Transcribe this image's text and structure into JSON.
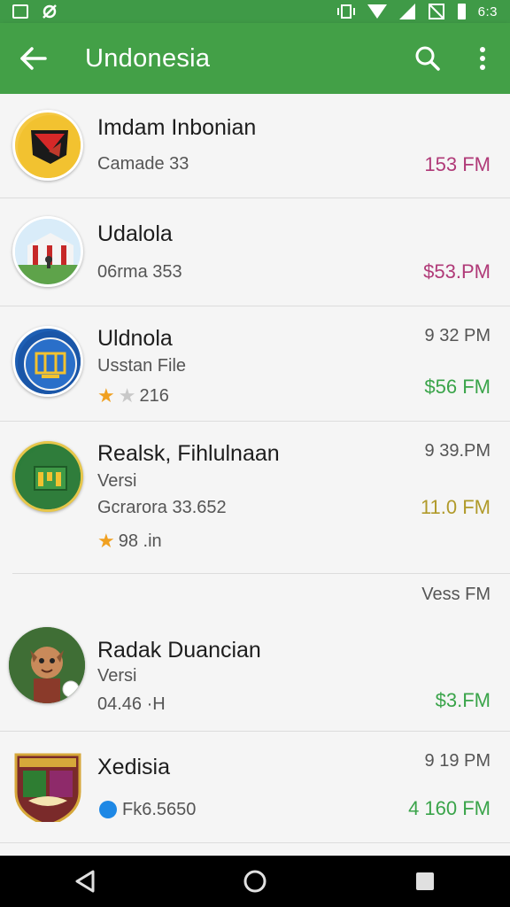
{
  "status": {
    "time": "6:3"
  },
  "appbar": {
    "title": "Undonesia",
    "bg_color": "#43a047"
  },
  "icons": {
    "back": "arrow-left-icon",
    "search": "search-icon",
    "menu": "more-vert-icon"
  },
  "items": [
    {
      "title": "Imdam Inbonian",
      "line2": "Camade 33",
      "amount": "153 FM",
      "amount_color": "#b03a78"
    },
    {
      "title": "Udalola",
      "line2": "06rma 353",
      "amount": "$53.PM",
      "amount_color": "#b03a78"
    },
    {
      "title": "Uldnola",
      "line2": "Usstan File",
      "rating": "216",
      "time": "9 32 PM",
      "amount": "$56 FM",
      "amount_color": "#3aa44a"
    },
    {
      "title": "Realsk, Fihlulnaan",
      "line2": "Versi",
      "line3": "Gcrarora 33.652",
      "rating": "98 .in",
      "time": "9 39.PM",
      "amount": "11.0 FM",
      "amount_color": "#b09a2a"
    },
    {
      "header_time": "Vess FM",
      "title": "Radak Duancian",
      "line2": "Versi",
      "line3": "04.46 ·H",
      "amount": "$3.FM",
      "amount_color": "#3aa44a"
    },
    {
      "title": "Xedisia",
      "line2": "Fk6.5650",
      "time": "9 19 PM",
      "amount": "4 160 FM",
      "amount_color": "#3aa44a"
    }
  ]
}
